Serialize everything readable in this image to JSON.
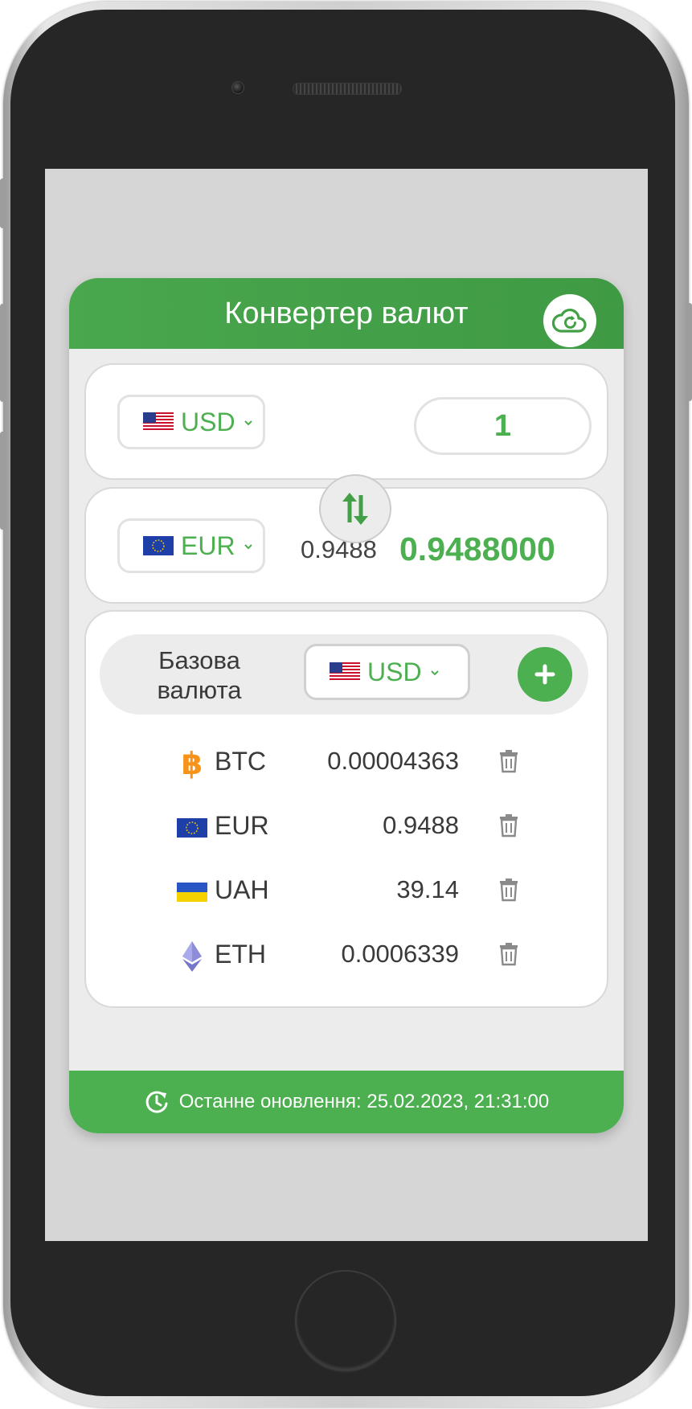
{
  "app": {
    "title": "Конвертер валют"
  },
  "converter": {
    "from": {
      "currency": "USD",
      "amount": "1"
    },
    "to": {
      "currency": "EUR",
      "rate": "0.9488",
      "result": "0.9488000"
    }
  },
  "rates": {
    "base_label": "Базова валюта",
    "base_currency": "USD",
    "items": [
      {
        "code": "BTC",
        "value": "0.00004363",
        "icon": "bitcoin-icon"
      },
      {
        "code": "EUR",
        "value": "0.9488",
        "icon": "eu-flag-icon"
      },
      {
        "code": "UAH",
        "value": "39.14",
        "icon": "ukraine-flag-icon"
      },
      {
        "code": "ETH",
        "value": "0.0006339",
        "icon": "ethereum-icon"
      }
    ]
  },
  "footer": {
    "last_updated": "Останне оновлення: 25.02.2023, 21:31:00"
  },
  "colors": {
    "accent": "#4caf50",
    "header": "#43a047",
    "bitcoin": "#f7931a",
    "ethereum": "#8c8cd8"
  }
}
